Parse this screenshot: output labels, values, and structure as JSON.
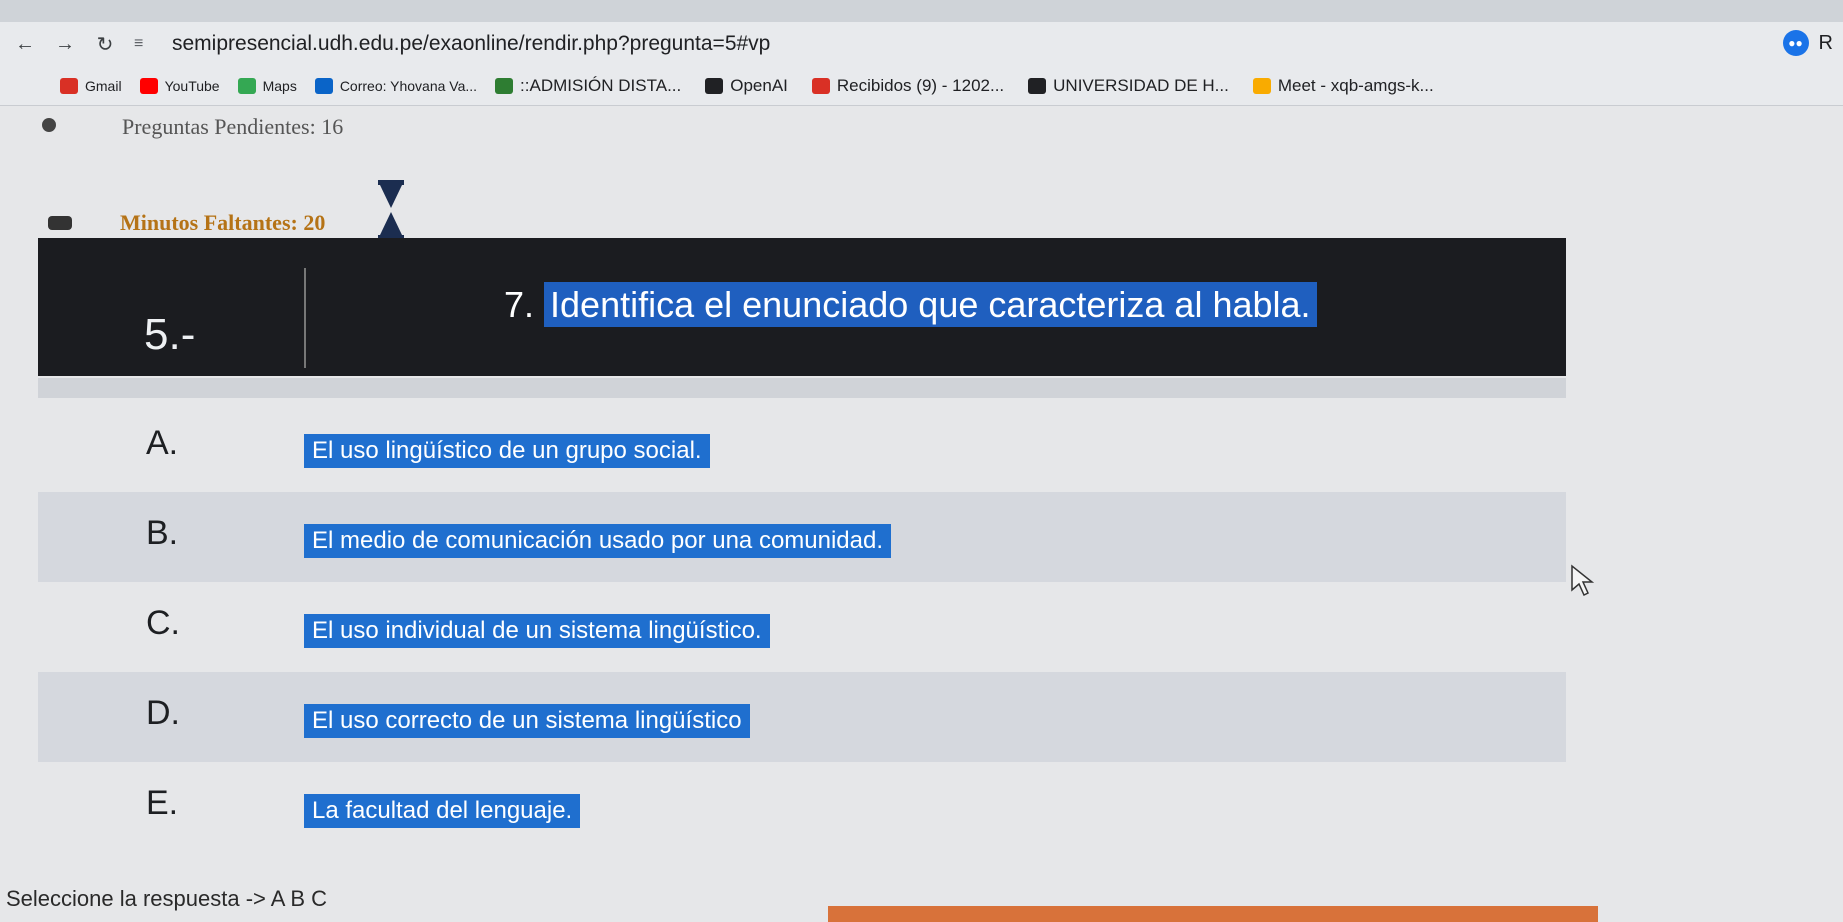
{
  "browser": {
    "url": "semipresencial.udh.edu.pe/exaonline/rendir.php?pregunta=5#vp",
    "profile_letter": "R",
    "bookmarks": [
      {
        "label": "Gmail",
        "color": "#d93025",
        "size": "sm"
      },
      {
        "label": "YouTube",
        "color": "#ff0000",
        "size": "sm"
      },
      {
        "label": "Maps",
        "color": "#34a853",
        "size": "sm"
      },
      {
        "label": "Correo: Yhovana Va...",
        "color": "#0a64c8",
        "size": "sm"
      },
      {
        "label": "::ADMISIÓN DISTA...",
        "color": "#2e7d32",
        "size": "md"
      },
      {
        "label": "OpenAI",
        "color": "#202124",
        "size": "md"
      },
      {
        "label": "Recibidos (9) - 1202...",
        "color": "#d93025",
        "size": "md"
      },
      {
        "label": "UNIVERSIDAD DE H...",
        "color": "#202124",
        "size": "md"
      },
      {
        "label": "Meet - xqb-amgs-k...",
        "color": "#f9ab00",
        "size": "md"
      }
    ]
  },
  "exam": {
    "pending_label": "Preguntas Pendientes: 16",
    "minutes_label": "Minutos Faltantes: 20",
    "question_number": "5.-",
    "question_text": "7. Identifica el enunciado que caracteriza al habla.",
    "options": [
      {
        "letter": "A.",
        "text": "El uso lingüístico de un grupo social."
      },
      {
        "letter": "B.",
        "text": "El medio de comunicación usado por una comunidad."
      },
      {
        "letter": "C.",
        "text": "El uso individual de un sistema lingüístico."
      },
      {
        "letter": "D.",
        "text": "El uso correcto de un sistema lingüístico"
      },
      {
        "letter": "E.",
        "text": "La facultad del lenguaje."
      }
    ],
    "select_prompt": "Seleccione la respuesta -> A  B  C"
  },
  "colors": {
    "highlight": "#1f6fcf",
    "question_bar": "#1b1c20",
    "minutes_text": "#b57316"
  }
}
